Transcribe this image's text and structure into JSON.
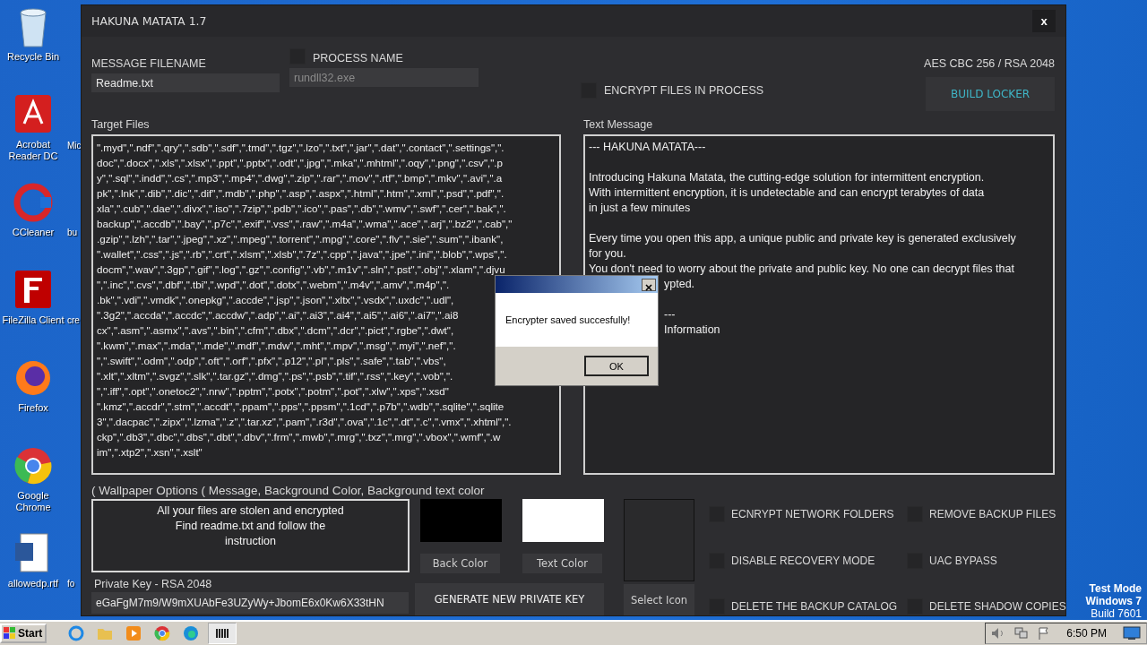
{
  "desktop": {
    "icons": [
      {
        "label": "Recycle Bin",
        "kind": "recycle"
      },
      {
        "label": "Acrobat Reader DC",
        "kind": "acrobat"
      },
      {
        "label": "CCleaner",
        "kind": "ccleaner"
      },
      {
        "label": "FileZilla Client",
        "kind": "filezilla"
      },
      {
        "label": "Firefox",
        "kind": "firefox"
      },
      {
        "label": "Google Chrome",
        "kind": "chrome"
      },
      {
        "label": "allowedp.rtf",
        "kind": "document"
      }
    ],
    "second_column_labels": [
      "Mic",
      "bu",
      "cre",
      "fo"
    ],
    "system_notice": [
      "Test Mode",
      "Windows 7",
      "Build 7601"
    ]
  },
  "window": {
    "title": "HAKUNA MATATA 1.7",
    "close": "x"
  },
  "message_filename": {
    "label": "MESSAGE FILENAME",
    "value": "Readme.txt"
  },
  "process_name": {
    "label": "PROCESS NAME",
    "value": "rundll32.exe",
    "checked": false,
    "disabled": true
  },
  "cipher_info": "AES CBC 256 / RSA 2048",
  "encrypt_in_process": {
    "label": "ENCRYPT FILES IN PROCESS",
    "checked": false
  },
  "build_button": "BUILD LOCKER",
  "target_files": {
    "label": "Target Files",
    "lines": [
      "\".myd\",\".ndf\",\".qry\",\".sdb\",\".sdf\",\".tmd\",\".tgz\",\".lzo\",\".txt\",\".jar\",\".dat\",\".contact\",\".settings\",\".",
      "doc\",\".docx\",\".xls\",\".xlsx\",\".ppt\",\".pptx\",\".odt\",\".jpg\",\".mka\",\".mhtml\",\".oqy\",\".png\",\".csv\",\".p",
      "y\",\".sql\",\".indd\",\".cs\",\".mp3\",\".mp4\",\".dwg\",\".zip\",\".rar\",\".mov\",\".rtf\",\".bmp\",\".mkv\",\".avi\",\".a",
      "pk\",\".lnk\",\".dib\",\".dic\",\".dif\",\".mdb\",\".php\",\".asp\",\".aspx\",\".html\",\".htm\",\".xml\",\".psd\",\".pdf\",\".",
      "xla\",\".cub\",\".dae\",\".divx\",\".iso\",\".7zip\",\".pdb\",\".ico\",\".pas\",\".db\",\".wmv\",\".swf\",\".cer\",\".bak\",\".",
      "backup\",\".accdb\",\".bay\",\".p7c\",\".exif\",\".vss\",\".raw\",\".m4a\",\".wma\",\".ace\",\".arj\",\".bz2\",\".cab\",\"",
      ".gzip\",\".lzh\",\".tar\",\".jpeg\",\".xz\",\".mpeg\",\".torrent\",\".mpg\",\".core\",\".flv\",\".sie\",\".sum\",\".ibank\",",
      "\".wallet\",\".css\",\".js\",\".rb\",\".crt\",\".xlsm\",\".xlsb\",\".7z\",\".cpp\",\".java\",\".jpe\",\".ini\",\".blob\",\".wps\",\".",
      "docm\",\".wav\",\".3gp\",\".gif\",\".log\",\".gz\",\".config\",\".vb\",\".m1v\",\".sln\",\".pst\",\".obj\",\".xlam\",\".djvu",
      "\",\".inc\",\".cvs\",\".dbf\",\".tbi\",\".wpd\",\".dot\",\".dotx\",\".webm\",\".m4v\",\".amv\",\".m4p\",\".",
      ".bk\",\".vdi\",\".vmdk\",\".onepkg\",\".accde\",\".jsp\",\".json\",\".xltx\",\".vsdx\",\".uxdc\",\".udl\",",
      "\".3g2\",\".accda\",\".accdc\",\".accdw\",\".adp\",\".ai\",\".ai3\",\".ai4\",\".ai5\",\".ai6\",\".ai7\",\".ai8",
      "cx\",\".asm\",\".asmx\",\".avs\",\".bin\",\".cfm\",\".dbx\",\".dcm\",\".dcr\",\".pict\",\".rgbe\",\".dwt\",",
      "\".kwm\",\".max\",\".mda\",\".mde\",\".mdf\",\".mdw\",\".mht\",\".mpv\",\".msg\",\".myi\",\".nef\",\".",
      "\",\".swift\",\".odm\",\".odp\",\".oft\",\".orf\",\".pfx\",\".p12\",\".pl\",\".pls\",\".safe\",\".tab\",\".vbs\",",
      "\".xlt\",\".xltm\",\".svgz\",\".slk\",\".tar.gz\",\".dmg\",\".ps\",\".psb\",\".tif\",\".rss\",\".key\",\".vob\",\".",
      "\",\".iff\",\".opt\",\".onetoc2\",\".nrw\",\".pptm\",\".potx\",\".potm\",\".pot\",\".xlw\",\".xps\",\".xsd\"",
      "\".kmz\",\".accdr\",\".stm\",\".accdt\",\".ppam\",\".pps\",\".ppsm\",\".1cd\",\".p7b\",\".wdb\",\".sqlite\",\".sqlite",
      "3\",\".dacpac\",\".zipx\",\".lzma\",\".z\",\".tar.xz\",\".pam\",\".r3d\",\".ova\",\".1c\",\".dt\",\".c\",\".vmx\",\".xhtml\",\".",
      "ckp\",\".db3\",\".dbc\",\".dbs\",\".dbt\",\".dbv\",\".frm\",\".mwb\",\".mrg\",\".txz\",\".mrg\",\".vbox\",\".wmf\",\".w",
      "im\",\".xtp2\",\".xsn\",\".xslt\""
    ]
  },
  "text_message": {
    "label": "Text Message",
    "lines": [
      {
        "kind": "text",
        "text": "--- HAKUNA MATATA---"
      },
      {
        "kind": "blank"
      },
      {
        "kind": "text",
        "text": "Introducing Hakuna Matata, the cutting-edge solution for intermittent encryption."
      },
      {
        "kind": "text",
        "text": "With intermittent encryption, it is undetectable and can encrypt terabytes of data"
      },
      {
        "kind": "text",
        "text": "in just a few minutes"
      },
      {
        "kind": "blank"
      },
      {
        "kind": "text",
        "text": "Every time you open this app, a unique public and private key is generated exclusively"
      },
      {
        "kind": "text",
        "text": "for you."
      },
      {
        "kind": "text",
        "text": "You don't need to worry about the private and public key. No one can decrypt files that"
      },
      {
        "kind": "partial",
        "text": "ypted."
      },
      {
        "kind": "blank"
      },
      {
        "kind": "partial",
        "text": "---"
      },
      {
        "kind": "partial",
        "text": "Information"
      }
    ]
  },
  "wallpaper": {
    "label": "( Wallpaper Options ( Message, Background Color, Background text color",
    "message_lines": [
      "All your files are stolen and encrypted",
      "Find readme.txt and follow the",
      "instruction"
    ],
    "back_color_button": "Back Color",
    "text_color_button": "Text Color"
  },
  "private_key": {
    "label": "Private Key - RSA 2048",
    "value": "eGaFgM7m9/W9mXUAbFe3UZyWy+JbomE6x0Kw6X33tHN"
  },
  "generate_button": "GENERATE NEW PRIVATE KEY",
  "select_icon_button": "Select Icon",
  "options": [
    {
      "label": "ECNRYPT NETWORK FOLDERS",
      "checked": false
    },
    {
      "label": "REMOVE BACKUP FILES",
      "checked": false
    },
    {
      "label": "DISABLE RECOVERY MODE",
      "checked": false
    },
    {
      "label": "UAC BYPASS",
      "checked": false
    },
    {
      "label": "DELETE THE BACKUP CATALOG",
      "checked": false
    },
    {
      "label": "DELETE SHADOW COPIES",
      "checked": false
    }
  ],
  "dialog": {
    "message": "Encrypter saved succesfully!",
    "button": "OK"
  },
  "taskbar": {
    "start": "Start",
    "clock": "6:50 PM"
  }
}
